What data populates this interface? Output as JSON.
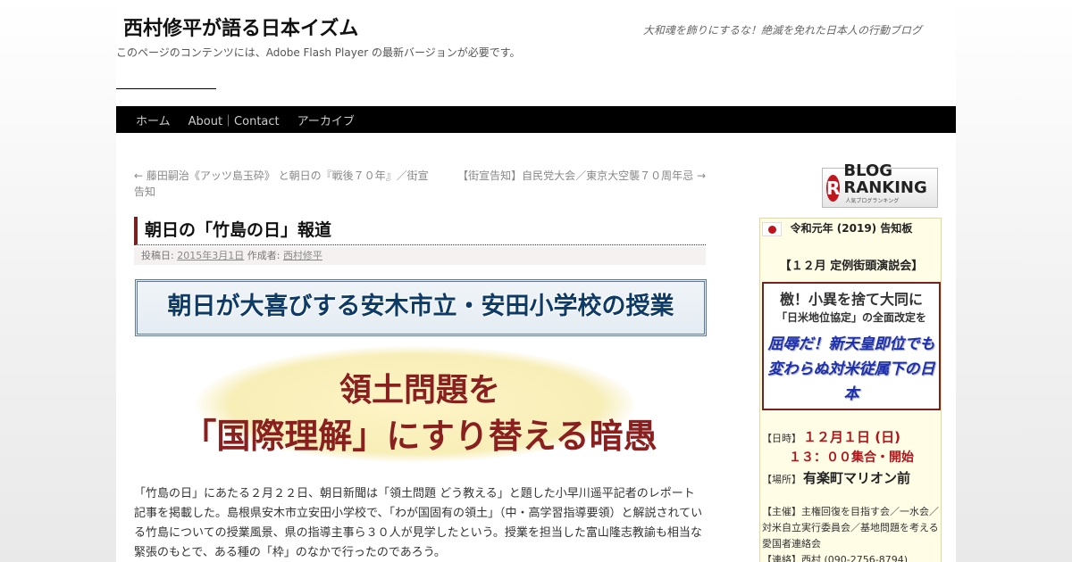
{
  "site": {
    "title": "西村修平が語る日本イズム",
    "description": "大和魂を飾りにするな！絶滅を免れた日本人の行動ブログ",
    "flash_message": "このページのコンテンツには、Adobe Flash Player の最新バージョンが必要です。"
  },
  "nav": {
    "items": [
      {
        "label": "ホーム"
      },
      {
        "label": "About｜Contact"
      },
      {
        "label": "アーカイブ"
      }
    ]
  },
  "post_nav": {
    "prev": "← 藤田嗣治《アッツ島玉砕》 と朝日の『戦後７０年』／街宣告知",
    "next": "【街宣告知】自民党大会／東京大空襲７０周年忌 →"
  },
  "post": {
    "title": "朝日の「竹島の日」報道",
    "meta_posted": "投稿日:",
    "meta_date": "2015年3月1日",
    "meta_author_label": "作成者:",
    "meta_author": "西村修平",
    "banner": "朝日が大喜びする安木市立・安田小学校の授業",
    "headline_1": "領土問題を",
    "headline_2": "「国際理解」にすり替える暗愚",
    "body": "「竹島の日」にあたる２月２２日、朝日新聞は「領土問題 どう教える」と題した小早川遥平記者のレポート記事を掲載した。島根県安木市立安田小学校で、「わが国固有の領土」（中・高学習指導要領）と解説されている竹島についての授業風景、県の指導主事ら３０人が見学したという。授業を担当した富山隆志教諭も相当な緊張のもとで、ある種の「枠」のなかで行ったのであろう。"
  },
  "sidebar": {
    "ranking_label": "BLOG RANKING",
    "ranking_small": "人気ブログランキング",
    "ranking_icon": "R",
    "notice": {
      "title": "令和元年 (2019) 告知板",
      "subtitle": "【１２月 定例街頭演説会】",
      "box_line1": "檄！小異を捨て大同に",
      "box_line2": "「日米地位協定」の全面改定を",
      "box_line3": "屈辱だ！新天皇即位でも変わらぬ対米従属下の日本",
      "when_label": "【日時】",
      "when_value": "１２月１日 (日)",
      "time_value": "１３：００集合・開始",
      "place_label": "【場所】",
      "place_value": "有楽町マリオン前",
      "host": "【主催】主権回復を目指す会／一水会／対米自立実行委員会／基地問題を考える愛国者連絡会",
      "contact": "【連絡】西村 (090-2756-8794)"
    }
  },
  "colors": {
    "nav_bg": "#000000",
    "title_accent": "#7b2020",
    "banner_text": "#0e3a66",
    "headline_text": "#8a1f1f",
    "event_red": "#b0151b",
    "event_blue": "#1a2fb5"
  },
  "icons": [
    "japan-flag-icon",
    "blog-ranking-logo-icon"
  ]
}
